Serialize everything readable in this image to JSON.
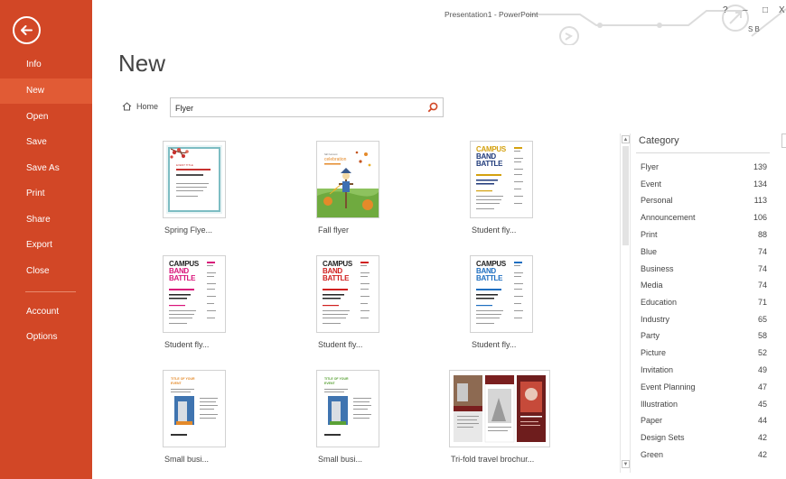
{
  "window": {
    "title": "Presentation1 - PowerPoint",
    "help": "?",
    "minimize": "–",
    "restore": "□",
    "close": "X",
    "user_initials": "S B"
  },
  "sidebar": {
    "items": [
      {
        "label": "Info"
      },
      {
        "label": "New"
      },
      {
        "label": "Open"
      },
      {
        "label": "Save"
      },
      {
        "label": "Save As"
      },
      {
        "label": "Print"
      },
      {
        "label": "Share"
      },
      {
        "label": "Export"
      },
      {
        "label": "Close"
      },
      {
        "label": "Account"
      },
      {
        "label": "Options"
      }
    ]
  },
  "main": {
    "title": "New",
    "home_label": "Home",
    "search_value": "Flyer",
    "templates": [
      {
        "label": "Spring Flye..."
      },
      {
        "label": "Fall flyer"
      },
      {
        "label": "Student fly..."
      },
      {
        "label": "Student fly..."
      },
      {
        "label": "Student fly..."
      },
      {
        "label": "Student fly..."
      },
      {
        "label": "Small busi..."
      },
      {
        "label": "Small busi..."
      },
      {
        "label": "Tri-fold travel brochur..."
      }
    ],
    "thumb_text": {
      "campus": "CAMPUS",
      "band": "BAND",
      "battle": "BATTLE",
      "fall_small": "fall harvest",
      "fall_big": "celebration",
      "spring_title": "EVENT TITLE",
      "biz_title": "TITLE OF YOUR",
      "biz_sub": "EVENT"
    }
  },
  "category": {
    "header": "Category",
    "items": [
      {
        "name": "Flyer",
        "count": "139"
      },
      {
        "name": "Event",
        "count": "134"
      },
      {
        "name": "Personal",
        "count": "113"
      },
      {
        "name": "Announcement",
        "count": "106"
      },
      {
        "name": "Print",
        "count": "88"
      },
      {
        "name": "Blue",
        "count": "74"
      },
      {
        "name": "Business",
        "count": "74"
      },
      {
        "name": "Media",
        "count": "74"
      },
      {
        "name": "Education",
        "count": "71"
      },
      {
        "name": "Industry",
        "count": "65"
      },
      {
        "name": "Party",
        "count": "58"
      },
      {
        "name": "Picture",
        "count": "52"
      },
      {
        "name": "Invitation",
        "count": "49"
      },
      {
        "name": "Event Planning",
        "count": "47"
      },
      {
        "name": "Illustration",
        "count": "45"
      },
      {
        "name": "Paper",
        "count": "44"
      },
      {
        "name": "Design Sets",
        "count": "42"
      },
      {
        "name": "Green",
        "count": "42"
      }
    ]
  },
  "colors": {
    "sidebar": "#d24726",
    "sidebar_active": "#e15b35",
    "accent": "#d24726"
  }
}
